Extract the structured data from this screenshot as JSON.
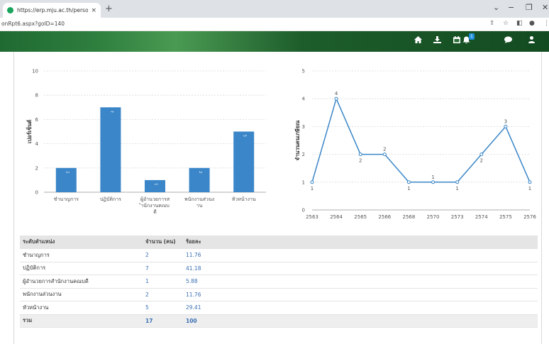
{
  "browser": {
    "tab_title": "https://erp.mju.ac.th/personRpt",
    "tab_close": "×",
    "new_tab": "+",
    "url": "onRpt6.aspx?goID=140",
    "win_minimize": "−",
    "win_restore": "❐",
    "win_close": "✕",
    "win_chevron": "⌄"
  },
  "header": {
    "notification_count": "1",
    "icons": [
      "home-icon",
      "download-icon",
      "calendar-icon",
      "bell-icon",
      "chat-icon",
      "user-icon"
    ]
  },
  "colors": {
    "bar": "#3a86c8",
    "line": "#3a86c8",
    "header_green": "#1f6a31"
  },
  "chart_data": [
    {
      "type": "bar",
      "ylabel": "เปอร์เซ็นต์",
      "ylim": [
        0,
        10
      ],
      "yticks": [
        "0",
        "2",
        "4",
        "6",
        "8",
        "10"
      ],
      "categories": [
        [
          "ชำนาญการ"
        ],
        [
          "ปฏิบัติการ"
        ],
        [
          "ผู้อำนวยการส",
          "ำนักงานคณบ",
          "ดี"
        ],
        [
          "พนักงานส่วนง",
          "าน"
        ],
        [
          "หัวหน้างาน"
        ]
      ],
      "values": [
        2,
        7,
        1,
        2,
        5
      ],
      "value_labels": [
        "2",
        "7",
        "1",
        "2",
        "5"
      ]
    },
    {
      "type": "line",
      "ylabel": "จำนวนคนเกษียณ",
      "ylim": [
        0,
        5
      ],
      "yticks": [
        "0",
        "1",
        "2",
        "3",
        "4",
        "5"
      ],
      "x": [
        "2563",
        "2564",
        "2565",
        "2566",
        "2568",
        "2570",
        "2573",
        "2574",
        "2575",
        "2576"
      ],
      "values": [
        1,
        4,
        2,
        2,
        1,
        1,
        1,
        2,
        3,
        1
      ],
      "value_labels": [
        "1",
        "4",
        "2",
        "2",
        "1",
        "1",
        "1",
        "2",
        "3",
        "1"
      ]
    }
  ],
  "table": {
    "headers": [
      "ระดับตำแหน่ง",
      "จำนวน (คน)",
      "ร้อยละ"
    ],
    "rows": [
      {
        "level": "ชำนาญการ",
        "count": "2",
        "percent": "11.76"
      },
      {
        "level": "ปฏิบัติการ",
        "count": "7",
        "percent": "41.18"
      },
      {
        "level": "ผู้อำนวยการสำนักงานคณบดี",
        "count": "1",
        "percent": "5.88"
      },
      {
        "level": "พนักงานส่วนงาน",
        "count": "2",
        "percent": "11.76"
      },
      {
        "level": "หัวหน้างาน",
        "count": "5",
        "percent": "29.41"
      }
    ],
    "total": {
      "label": "รวม",
      "count": "17",
      "percent": "100"
    }
  }
}
